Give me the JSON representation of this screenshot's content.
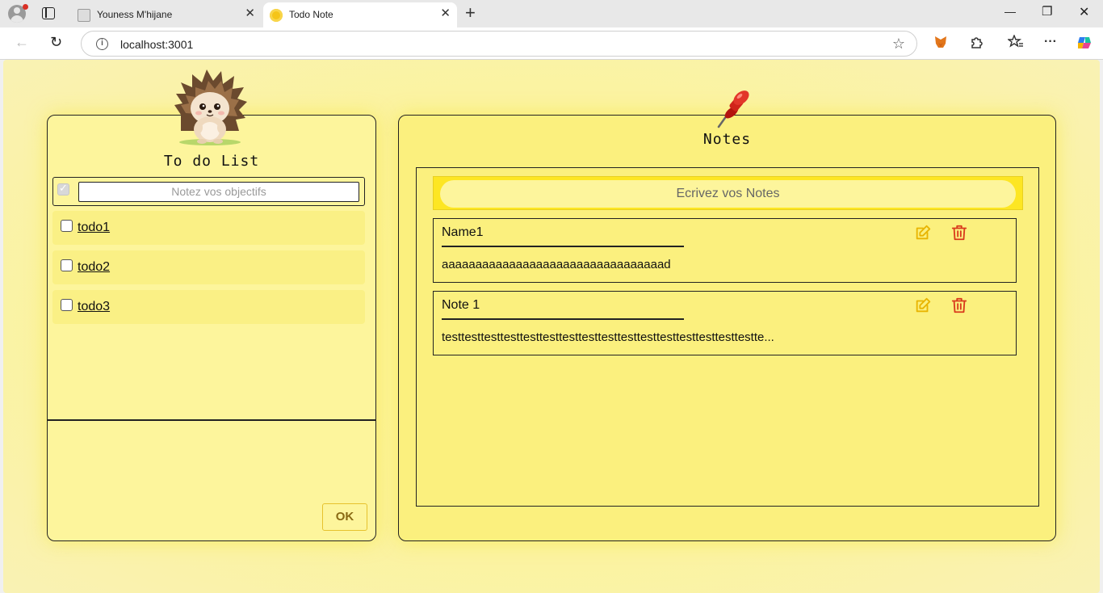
{
  "browser": {
    "tabs": [
      {
        "title": "Youness M'hijane",
        "active": false
      },
      {
        "title": "Todo Note",
        "active": true
      }
    ],
    "url": "localhost:3001"
  },
  "todo": {
    "title": "To do List",
    "input_placeholder": "Notez vos objectifs",
    "items": [
      {
        "label": "todo1",
        "checked": false
      },
      {
        "label": "todo2",
        "checked": false
      },
      {
        "label": "todo3",
        "checked": false
      }
    ],
    "ok_label": "OK"
  },
  "notes": {
    "title": "Notes",
    "search_placeholder": "Ecrivez vos Notes",
    "cards": [
      {
        "title": "Name1",
        "body": "aaaaaaaaaaaaaaaaaaaaaaaaaaaaaaaaad"
      },
      {
        "title": "Note 1",
        "body": "testtesttesttesttesttesttesttesttesttesttesttesttesttesttesttestte..."
      }
    ]
  },
  "colors": {
    "page_bg": "#fbf3a0",
    "panel_bg": "#fdf59c",
    "notes_panel_bg": "#fbf07e",
    "search_band": "#fde623",
    "edit_icon": "#e8b400",
    "delete_icon": "#d93a1c",
    "ok_text": "#8a6a14"
  },
  "icons": [
    "profile-icon",
    "tab-actions-icon",
    "back-icon",
    "reload-icon",
    "info-icon",
    "star-icon",
    "metamask-icon",
    "extensions-icon",
    "favorites-icon",
    "more-icon",
    "copilot-icon",
    "hedgehog-icon",
    "pushpin-icon",
    "edit-icon",
    "trash-icon"
  ]
}
